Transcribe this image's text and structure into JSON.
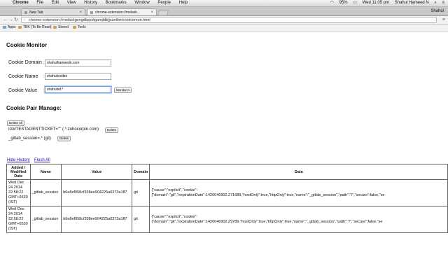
{
  "menubar": {
    "apple_glyph": "",
    "items": [
      "Chrome",
      "File",
      "Edit",
      "View",
      "History",
      "Bookmarks",
      "Window",
      "People",
      "Help"
    ],
    "status": [
      "95%",
      "Wed 11:05 pm",
      "Shahul Hameed N"
    ]
  },
  "tabs": [
    {
      "title": "New Tab"
    },
    {
      "title": "chrome-extension://melaxk..."
    }
  ],
  "profile_name": "Shahul",
  "address": {
    "url": "chrome-extension://melaxkgcngdkppdigamjbfbjjsunlhm/cookiemon.html"
  },
  "bookmarks": [
    {
      "label": "Apps"
    },
    {
      "label": "TBK (To Be Read)"
    },
    {
      "label": "Stored"
    },
    {
      "label": "Tools"
    }
  ],
  "page": {
    "title": "Cookie Monitor",
    "domain_label": "Cookie Domain",
    "domain_value": "shahulhameedn.com",
    "name_label": "Cookie Name",
    "name_value": "shahulcookie",
    "value_label": "Cookie Value",
    "value_value": "shahulsd.*",
    "monitor_button": "Monitor It",
    "colon": ":",
    "pair_title": "Cookie Pair Manage:",
    "delete_all": "Delete All",
    "pairs": [
      {
        "text": "IAMTESTAGENTTICKET=\"\" (.*.zohocorpin.com)",
        "button": "Delete"
      },
      {
        "text": "_gitlab_session=.* (git)",
        "button": "Delete"
      }
    ],
    "hide_history": "Hide History",
    "flush_all": "Flush All"
  },
  "history": {
    "headers": [
      "Added / Modified Date",
      "Name",
      "Value",
      "Domain",
      "Data"
    ],
    "rows": [
      {
        "date": "Wed Dec 24 2014 22:58:22 GMT+0530 (IST)",
        "name": "_gitlab_session",
        "value": "b6e8ef958cf338ee904225a0373a1ff7",
        "domain": "git",
        "data_line1": "{\"cause\":\"explicit\",\"cookie\":",
        "data_line2": "{\"domain\":\"git\",\"expirationDate\":1420046902.271689,\"hostOnly\":true,\"httpOnly\":true,\"name\":\"_gitlab_session\",\"path\":\"/\",\"secure\":false,\"se"
      },
      {
        "date": "Wed Dec 24 2014 22:58:22 GMT+0530 (IST)",
        "name": "_gitlab_session",
        "value": "b6e8ef958cf338ee904225a0373a1ff7",
        "domain": "git",
        "data_line1": "{\"cause\":\"explicit\",\"cookie\":",
        "data_line2": "{\"domain\":\"git\",\"expirationDate\":1420046902.29789,\"hostOnly\":true,\"httpOnly\":true,\"name\":\"_gitlab_session\",\"path\":\"/\",\"secure\":false,\"se"
      }
    ]
  }
}
